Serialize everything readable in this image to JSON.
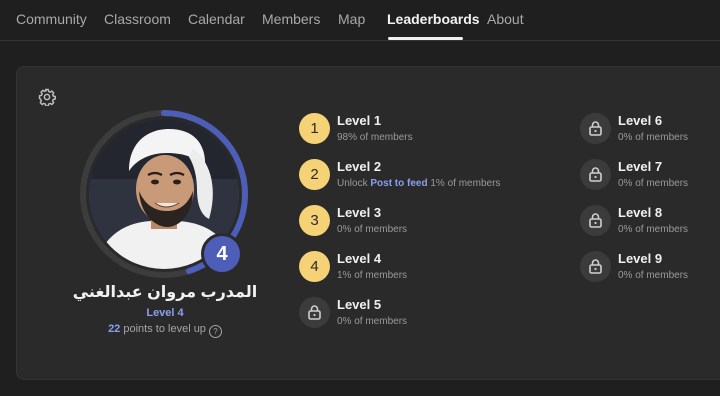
{
  "nav": {
    "tabs": [
      {
        "label": "Community"
      },
      {
        "label": "Classroom"
      },
      {
        "label": "Calendar"
      },
      {
        "label": "Members"
      },
      {
        "label": "Map"
      },
      {
        "label": "Leaderboards"
      },
      {
        "label": "About"
      }
    ],
    "active": "Leaderboards"
  },
  "profile": {
    "name": "المدرب مروان عبدالغني",
    "level_label": "Level 4",
    "level_number": "4",
    "points_to_level": "22",
    "points_suffix": "points to level up",
    "progress_fraction": 0.45,
    "accent_color": "#4c5eb8"
  },
  "levels": [
    {
      "title": "Level 1",
      "badge": "1",
      "locked": false,
      "sub": "98% of members"
    },
    {
      "title": "Level 2",
      "badge": "2",
      "locked": false,
      "sub_prefix": "Unlock",
      "sub_link": "Post to feed",
      "sub": "1% of members"
    },
    {
      "title": "Level 3",
      "badge": "3",
      "locked": false,
      "sub": "0% of members"
    },
    {
      "title": "Level 4",
      "badge": "4",
      "locked": false,
      "sub": "1% of members"
    },
    {
      "title": "Level 5",
      "badge": "lock-icon",
      "locked": true,
      "sub": "0% of members"
    },
    {
      "title": "Level 6",
      "badge": "lock-icon",
      "locked": true,
      "sub": "0% of members"
    },
    {
      "title": "Level 7",
      "badge": "lock-icon",
      "locked": true,
      "sub": "0% of members"
    },
    {
      "title": "Level 8",
      "badge": "lock-icon",
      "locked": true,
      "sub": "0% of members"
    },
    {
      "title": "Level 9",
      "badge": "lock-icon",
      "locked": true,
      "sub": "0% of members"
    }
  ],
  "icons": {
    "settings": "gear-icon",
    "help": "question-icon"
  }
}
